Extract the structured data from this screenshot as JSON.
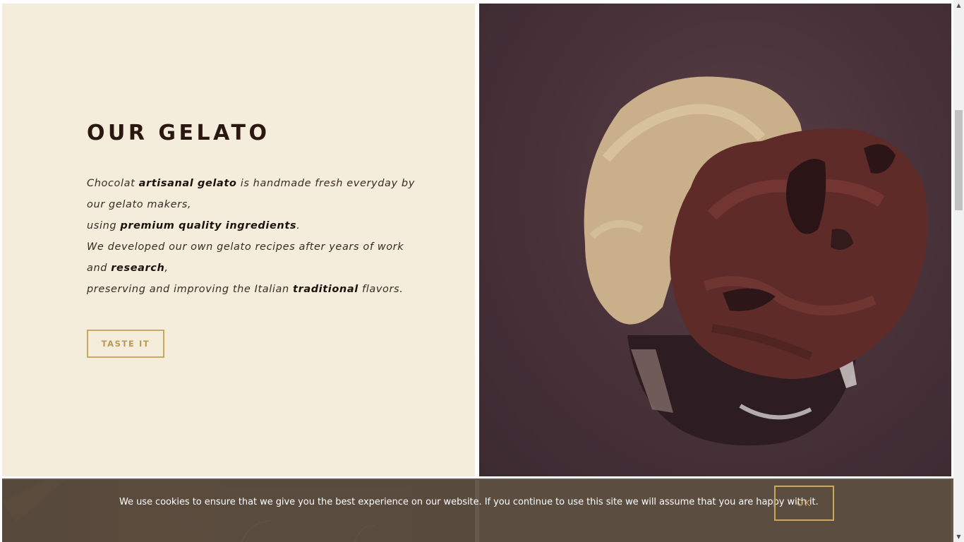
{
  "intro": {
    "heading": "OUR GELATO",
    "paragraph": [
      [
        {
          "t": "Chocolat "
        },
        {
          "t": "artisanal gelato",
          "b": true
        },
        {
          "t": " is handmade fresh everyday by"
        }
      ],
      [
        {
          "t": "our gelato makers,"
        }
      ],
      [
        {
          "t": "using "
        },
        {
          "t": "premium quality ingredients",
          "b": true
        },
        {
          "t": "."
        }
      ],
      [
        {
          "t": "We developed our own gelato recipes after years of work"
        }
      ],
      [
        {
          "t": "and "
        },
        {
          "t": "research",
          "b": true
        },
        {
          "t": ","
        }
      ],
      [
        {
          "t": "preserving and improving the Italian "
        },
        {
          "t": "traditional",
          "b": true
        },
        {
          "t": " flavors."
        }
      ]
    ],
    "button_label": "TASTE IT"
  },
  "photo": {
    "icon": "gelato-cup-photo"
  },
  "cookie_notice": {
    "message": "We use cookies to ensure that we give you the best experience on our website. If you continue to use this site we will assume that you are happy with it.",
    "ok_label": "OK"
  },
  "colors": {
    "panel_bg": "#f4eddc",
    "heading": "#2a1710",
    "accent_gold": "#c9a95f",
    "cookie_bar": "#5a4c40"
  }
}
